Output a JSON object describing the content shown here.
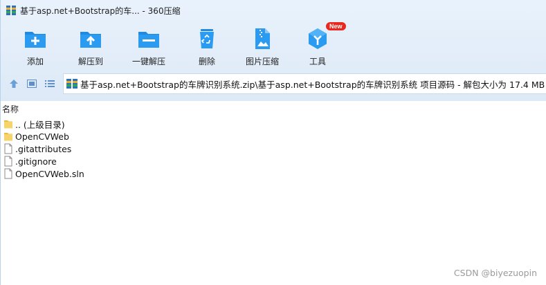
{
  "window": {
    "title": "基于asp.net+Bootstrap的车... - 360压缩"
  },
  "toolbar": {
    "items": [
      {
        "label": "添加",
        "icon": "add-folder-icon"
      },
      {
        "label": "解压到",
        "icon": "extract-to-folder-icon"
      },
      {
        "label": "一键解压",
        "icon": "one-click-extract-folder-icon"
      },
      {
        "label": "删除",
        "icon": "recycle-bin-icon"
      },
      {
        "label": "图片压缩",
        "icon": "image-zip-icon"
      },
      {
        "label": "工具",
        "icon": "tools-cube-icon",
        "badge": "New"
      }
    ]
  },
  "address": {
    "path": "基于asp.net+Bootstrap的车牌识别系统.zip\\基于asp.net+Bootstrap的车牌识别系统 项目源码 - 解包大小为 17.4 MB"
  },
  "list": {
    "column_name": "名称",
    "rows": [
      {
        "name": ".. (上级目录)",
        "icon": "folder-icon"
      },
      {
        "name": "OpenCVWeb",
        "icon": "folder-icon"
      },
      {
        "name": ".gitattributes",
        "icon": "file-icon"
      },
      {
        "name": ".gitignore",
        "icon": "file-icon"
      },
      {
        "name": "OpenCVWeb.sln",
        "icon": "file-icon"
      }
    ]
  },
  "watermark": "CSDN @biyezuopin",
  "colors": {
    "accent": "#1e88d6",
    "chrome": "#e4eefa",
    "badge": "#e8281f",
    "folder": "#f6d36b"
  }
}
